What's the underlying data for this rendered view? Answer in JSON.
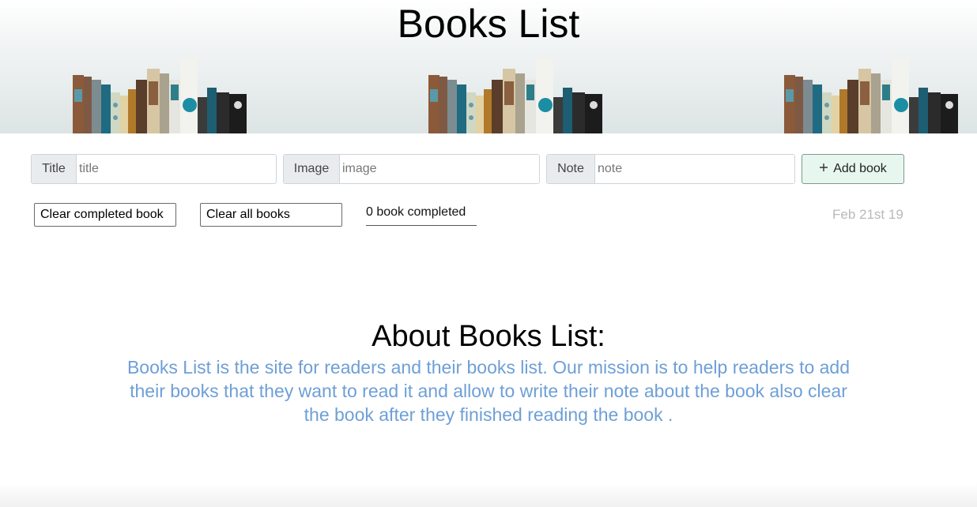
{
  "header": {
    "title": "Books List"
  },
  "form": {
    "title_label": "Title",
    "title_placeholder": "title",
    "image_label": "Image",
    "image_placeholder": "image",
    "note_label": "Note",
    "note_placeholder": "note",
    "add_button_icon": "plus-icon",
    "add_button_label": "Add book"
  },
  "controls": {
    "clear_completed_label": "Clear completed book",
    "clear_all_label": "Clear all books",
    "completed_count": "0 book completed",
    "date": "Feb 21st 19"
  },
  "about": {
    "title": "About Books List:",
    "text": "Books List is the site for readers and their books list. Our mission is to help readers to add their books that they want to read it and allow to write their note about the book also clear the book after they finished reading the book ."
  },
  "colors": {
    "about_text": "#6e9fd6",
    "add_button_bg": "#e8f6f0",
    "date_text": "#b9b9b9"
  }
}
